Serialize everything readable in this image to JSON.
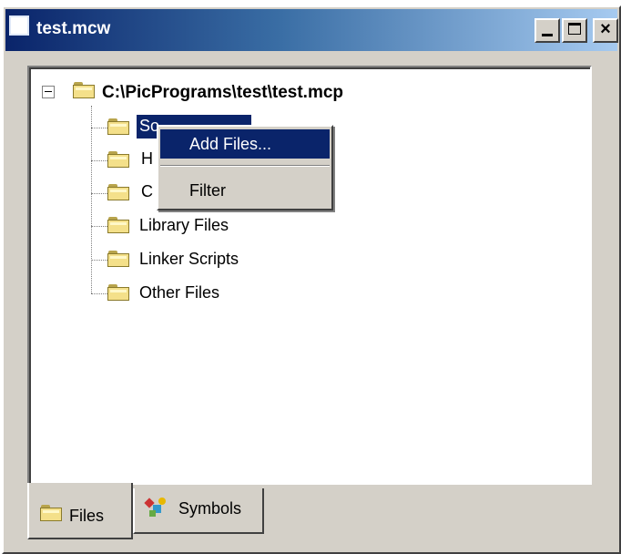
{
  "window": {
    "title": "test.mcw",
    "min_label": "_",
    "close_label": "×"
  },
  "tree": {
    "root": "C:\\PicPrograms\\test\\test.mcp",
    "items": [
      {
        "label": "So",
        "icon": "folder-icon"
      },
      {
        "label": "H",
        "icon": "folder-icon"
      },
      {
        "label": "C",
        "icon": "folder-icon"
      },
      {
        "label": "Library Files",
        "icon": "folder-icon"
      },
      {
        "label": "Linker Scripts",
        "icon": "folder-icon"
      },
      {
        "label": "Other Files",
        "icon": "folder-icon"
      }
    ]
  },
  "context_menu": {
    "items": [
      {
        "label": "Add Files...",
        "highlighted": true
      },
      {
        "label": "Filter",
        "highlighted": false
      }
    ]
  },
  "tabs": [
    {
      "label": "Files",
      "active": true,
      "icon": "folder-icon"
    },
    {
      "label": "Symbols",
      "active": false,
      "icon": "symbols-icon"
    }
  ],
  "colors": {
    "title_active": "#0a246a",
    "selection": "#0a246a",
    "face": "#d4d0c8",
    "folder": "#f4e08a"
  }
}
